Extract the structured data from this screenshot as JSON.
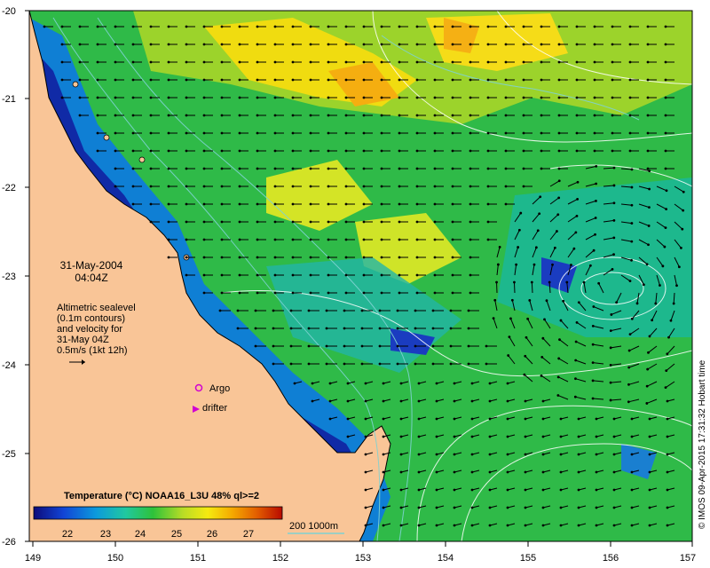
{
  "map": {
    "date_label": "31-May-2004",
    "time_label": "04:04Z",
    "legend_lines": [
      "Altimetric sealevel",
      "(0.1m contours)",
      "and velocity for",
      "31-May 04Z",
      "0.5m/s (1kt 12h)"
    ],
    "argo_label": "Argo",
    "drifter_label": "drifter",
    "colorbar_title": "Temperature (°C) NOAA16_L3U 48% ql>=2",
    "colorbar_ticks": [
      "22",
      "23",
      "24",
      "25",
      "26",
      "27"
    ],
    "depth_contour_label": "200  1000m",
    "credit": "© IMOS 09-Apr-2015 17:31:32 Hobart time",
    "x_ticks": [
      "149",
      "150",
      "151",
      "152",
      "153",
      "154",
      "155",
      "156",
      "157"
    ],
    "y_ticks": [
      "-20",
      "-21",
      "-22",
      "-23",
      "-24",
      "-25",
      "-26"
    ],
    "colors": {
      "land": "#f9c597",
      "colorbar": [
        "#0c0c7a",
        "#1144d6",
        "#0c9adc",
        "#20c8a0",
        "#2ec23a",
        "#b8dc26",
        "#f5ea10",
        "#f5a800",
        "#e25c00",
        "#b80a00"
      ],
      "argo": "#d100d1",
      "drifter": "#d100d1",
      "contour": "#ffffff",
      "depth_contour": "#7fd2d2"
    }
  }
}
